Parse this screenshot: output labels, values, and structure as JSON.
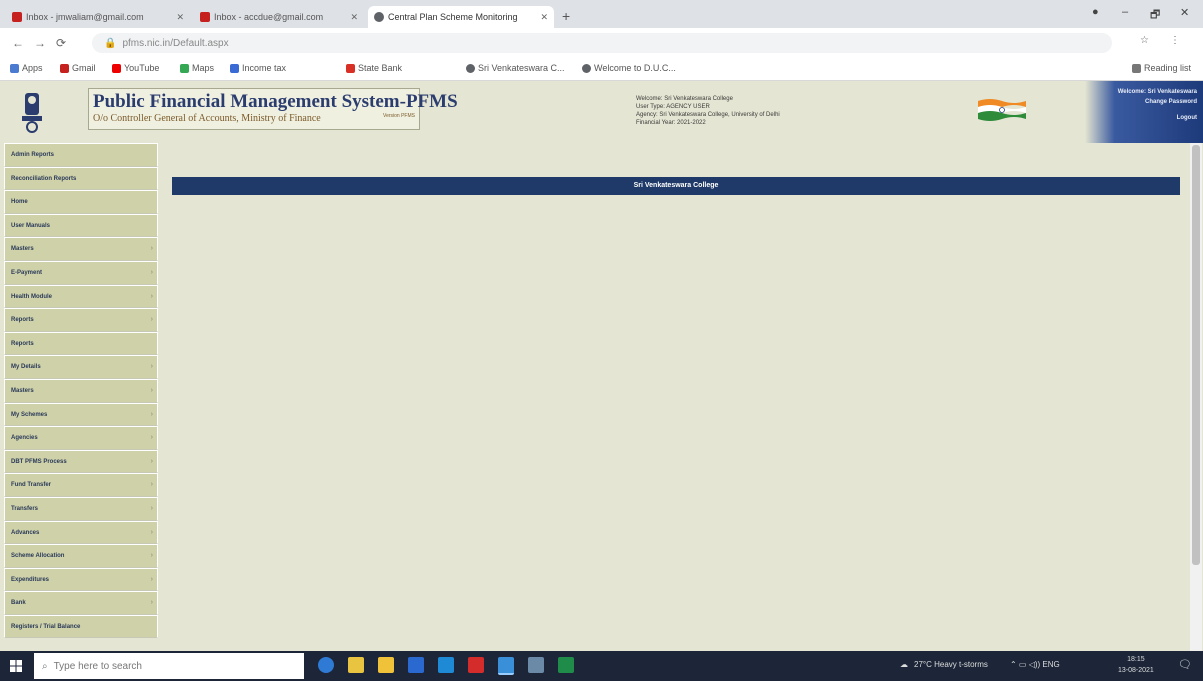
{
  "browser": {
    "tabs": [
      {
        "label": "Inbox - jmwaliam@gmail.com",
        "fav": "#c5221f"
      },
      {
        "label": "Inbox - accdue@gmail.com",
        "fav": "#c5221f"
      },
      {
        "label": "Central Plan Scheme Monitoring",
        "fav": "#5f6368",
        "active": true
      }
    ],
    "new_tab": "+",
    "window_controls": [
      "●",
      "–",
      "🗗",
      "✕"
    ],
    "nav": [
      "←",
      "→",
      "⟳"
    ],
    "url": "pfms.nic.in/Default.aspx",
    "bookmarks": [
      "Apps",
      "Gmail",
      "YouTube",
      "Maps",
      "Income tax",
      "State Bank",
      "Sri Venkateswara C...",
      "Welcome to D.U.C..."
    ],
    "reading_list": "Reading list"
  },
  "header": {
    "title": "Public Financial Management System-PFMS",
    "subtitle": "O/o Controller General of Accounts, Ministry of Finance",
    "version": "Version PFMS",
    "user_lines": [
      "Welcome: Sri Venkateswara College",
      "User Type: AGENCY USER",
      "Agency: Sri Venkateswara College, University of Delhi",
      "Financial Year: 2021-2022"
    ],
    "right_lines": [
      "Welcome: Sri Venkateswara",
      "Change Password",
      "Logout"
    ]
  },
  "sidebar": {
    "items": [
      {
        "label": "Admin Reports",
        "arrow": false
      },
      {
        "label": "Reconciliation Reports",
        "arrow": false
      },
      {
        "label": "Home",
        "arrow": false
      },
      {
        "label": "User Manuals",
        "arrow": false
      },
      {
        "label": "Masters",
        "arrow": true
      },
      {
        "label": "E-Payment",
        "arrow": true
      },
      {
        "label": "Health Module",
        "arrow": true
      },
      {
        "label": "Reports",
        "arrow": true
      },
      {
        "label": "Reports",
        "arrow": false
      },
      {
        "label": "My Details",
        "arrow": true
      },
      {
        "label": "Masters",
        "arrow": true
      },
      {
        "label": "My Schemes",
        "arrow": true
      },
      {
        "label": "Agencies",
        "arrow": true
      },
      {
        "label": "DBT PFMS Process",
        "arrow": true
      },
      {
        "label": "Fund Transfer",
        "arrow": true
      },
      {
        "label": "Transfers",
        "arrow": true
      },
      {
        "label": "Advances",
        "arrow": true
      },
      {
        "label": "Scheme Allocation",
        "arrow": true
      },
      {
        "label": "Expenditures",
        "arrow": true
      },
      {
        "label": "Bank",
        "arrow": true
      },
      {
        "label": "Registers / Trial Balance",
        "arrow": false
      }
    ]
  },
  "main": {
    "banner": "Sri Venkateswara College"
  },
  "taskbar": {
    "search_placeholder": "Type here to search",
    "weather": "27°C Heavy t-storms",
    "time": "18:15",
    "date": "13-08-2021"
  },
  "colors": {
    "banner_bg": "#1f3a68",
    "sidebar_bg": "#cfd1a8",
    "page_bg": "#e4e5d2"
  }
}
